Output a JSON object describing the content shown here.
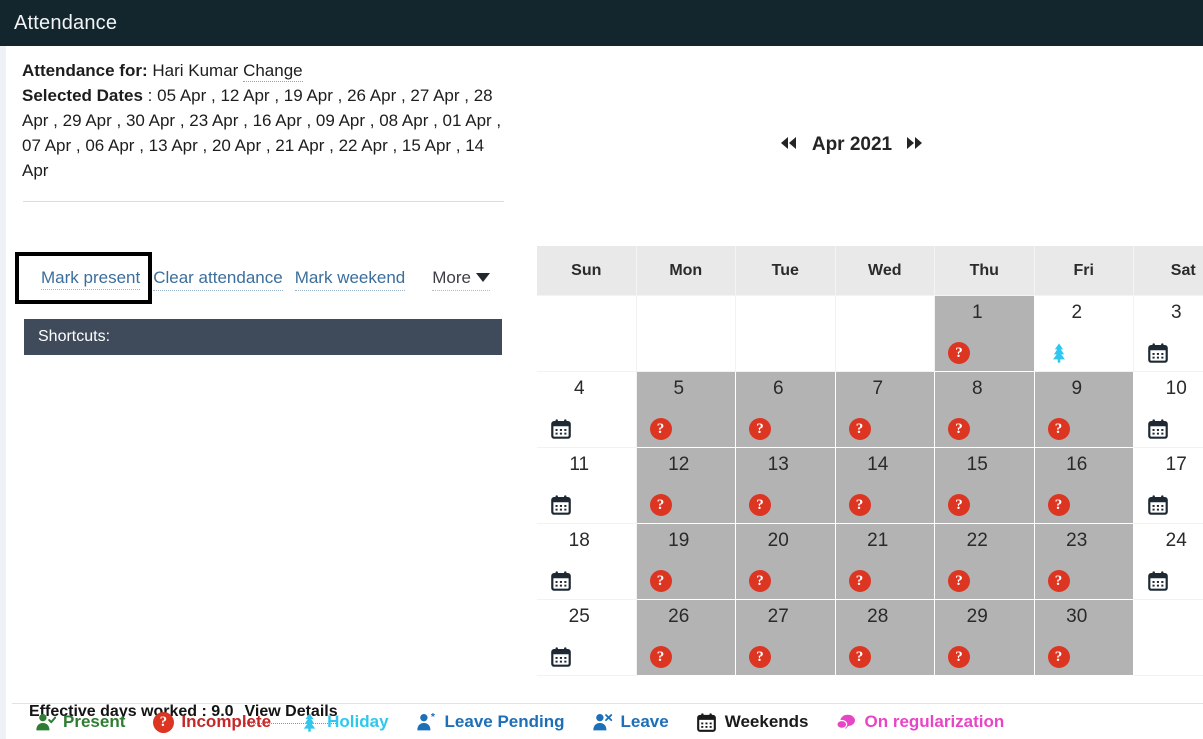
{
  "titlebar": {
    "title": "Attendance"
  },
  "info": {
    "attendance_for_label": "Attendance for:",
    "employee_name": "Hari Kumar",
    "change_link": "Change",
    "selected_dates_label": "Selected Dates",
    "selected_dates_sep": " : ",
    "selected_dates_value": "05 Apr , 12 Apr , 19 Apr , 26 Apr , 27 Apr , 28 Apr , 29 Apr , 30 Apr , 23 Apr , 16 Apr , 09 Apr , 08 Apr , 01 Apr , 07 Apr , 06 Apr , 13 Apr , 20 Apr , 21 Apr , 22 Apr , 15 Apr , 14 Apr"
  },
  "actions": {
    "mark_present": "Mark present",
    "clear_attendance": "Clear attendance",
    "mark_weekend": "Mark weekend",
    "more": "More",
    "more_caret_icon": "chevron-down-icon",
    "highlight_color": "#000000"
  },
  "shortcuts": {
    "label": "Shortcuts:"
  },
  "effective": {
    "label": "Effective days worked : 9.0",
    "view_details": "View Details"
  },
  "calendar": {
    "prev_icon": "⏪",
    "next_icon": "⏩",
    "month_label": "Apr 2021",
    "weekdays": [
      "Sun",
      "Mon",
      "Tue",
      "Wed",
      "Thu",
      "Fri",
      "Sat"
    ],
    "weeks": [
      [
        {
          "day": "",
          "state": "blank",
          "icon": ""
        },
        {
          "day": "",
          "state": "blank",
          "icon": ""
        },
        {
          "day": "",
          "state": "blank",
          "icon": ""
        },
        {
          "day": "",
          "state": "blank",
          "icon": ""
        },
        {
          "day": "1",
          "state": "selected",
          "icon": "incomplete-icon"
        },
        {
          "day": "2",
          "state": "normal",
          "icon": "holiday-icon"
        },
        {
          "day": "3",
          "state": "normal",
          "icon": "weekend-icon"
        }
      ],
      [
        {
          "day": "4",
          "state": "normal",
          "icon": "weekend-icon"
        },
        {
          "day": "5",
          "state": "selected",
          "icon": "incomplete-icon"
        },
        {
          "day": "6",
          "state": "selected",
          "icon": "incomplete-icon"
        },
        {
          "day": "7",
          "state": "selected",
          "icon": "incomplete-icon"
        },
        {
          "day": "8",
          "state": "selected",
          "icon": "incomplete-icon"
        },
        {
          "day": "9",
          "state": "selected",
          "icon": "incomplete-icon"
        },
        {
          "day": "10",
          "state": "normal",
          "icon": "weekend-icon"
        }
      ],
      [
        {
          "day": "11",
          "state": "normal",
          "icon": "weekend-icon"
        },
        {
          "day": "12",
          "state": "selected",
          "icon": "incomplete-icon"
        },
        {
          "day": "13",
          "state": "selected",
          "icon": "incomplete-icon"
        },
        {
          "day": "14",
          "state": "selected",
          "icon": "incomplete-icon"
        },
        {
          "day": "15",
          "state": "selected",
          "icon": "incomplete-icon"
        },
        {
          "day": "16",
          "state": "selected",
          "icon": "incomplete-icon"
        },
        {
          "day": "17",
          "state": "normal",
          "icon": "weekend-icon"
        }
      ],
      [
        {
          "day": "18",
          "state": "normal",
          "icon": "weekend-icon"
        },
        {
          "day": "19",
          "state": "selected",
          "icon": "incomplete-icon"
        },
        {
          "day": "20",
          "state": "selected",
          "icon": "incomplete-icon"
        },
        {
          "day": "21",
          "state": "selected",
          "icon": "incomplete-icon"
        },
        {
          "day": "22",
          "state": "selected",
          "icon": "incomplete-icon"
        },
        {
          "day": "23",
          "state": "selected",
          "icon": "incomplete-icon"
        },
        {
          "day": "24",
          "state": "normal",
          "icon": "weekend-icon"
        }
      ],
      [
        {
          "day": "25",
          "state": "normal",
          "icon": "weekend-icon"
        },
        {
          "day": "26",
          "state": "selected",
          "icon": "incomplete-icon"
        },
        {
          "day": "27",
          "state": "selected",
          "icon": "incomplete-icon"
        },
        {
          "day": "28",
          "state": "selected",
          "icon": "incomplete-icon"
        },
        {
          "day": "29",
          "state": "selected",
          "icon": "incomplete-icon"
        },
        {
          "day": "30",
          "state": "selected",
          "icon": "incomplete-icon"
        },
        {
          "day": "",
          "state": "blank",
          "icon": ""
        }
      ]
    ],
    "selected_bg": "#b3b3b3",
    "header_bg": "#e9e9e9"
  },
  "legend": [
    {
      "label": "Present",
      "icon": "present-icon",
      "color": "#2e7d32"
    },
    {
      "label": "Incomplete",
      "icon": "incomplete-icon",
      "color": "#c62828"
    },
    {
      "label": "Holiday",
      "icon": "holiday-icon",
      "color": "#2ec8ee"
    },
    {
      "label": "Leave Pending",
      "icon": "leave-pending-icon",
      "color": "#1d6fb8"
    },
    {
      "label": "Leave",
      "icon": "leave-icon",
      "color": "#1d6fb8"
    },
    {
      "label": "Weekends",
      "icon": "weekend-icon",
      "color": "#1a1a1a"
    },
    {
      "label": "On regularization",
      "icon": "regularization-icon",
      "color": "#e845c6"
    }
  ]
}
